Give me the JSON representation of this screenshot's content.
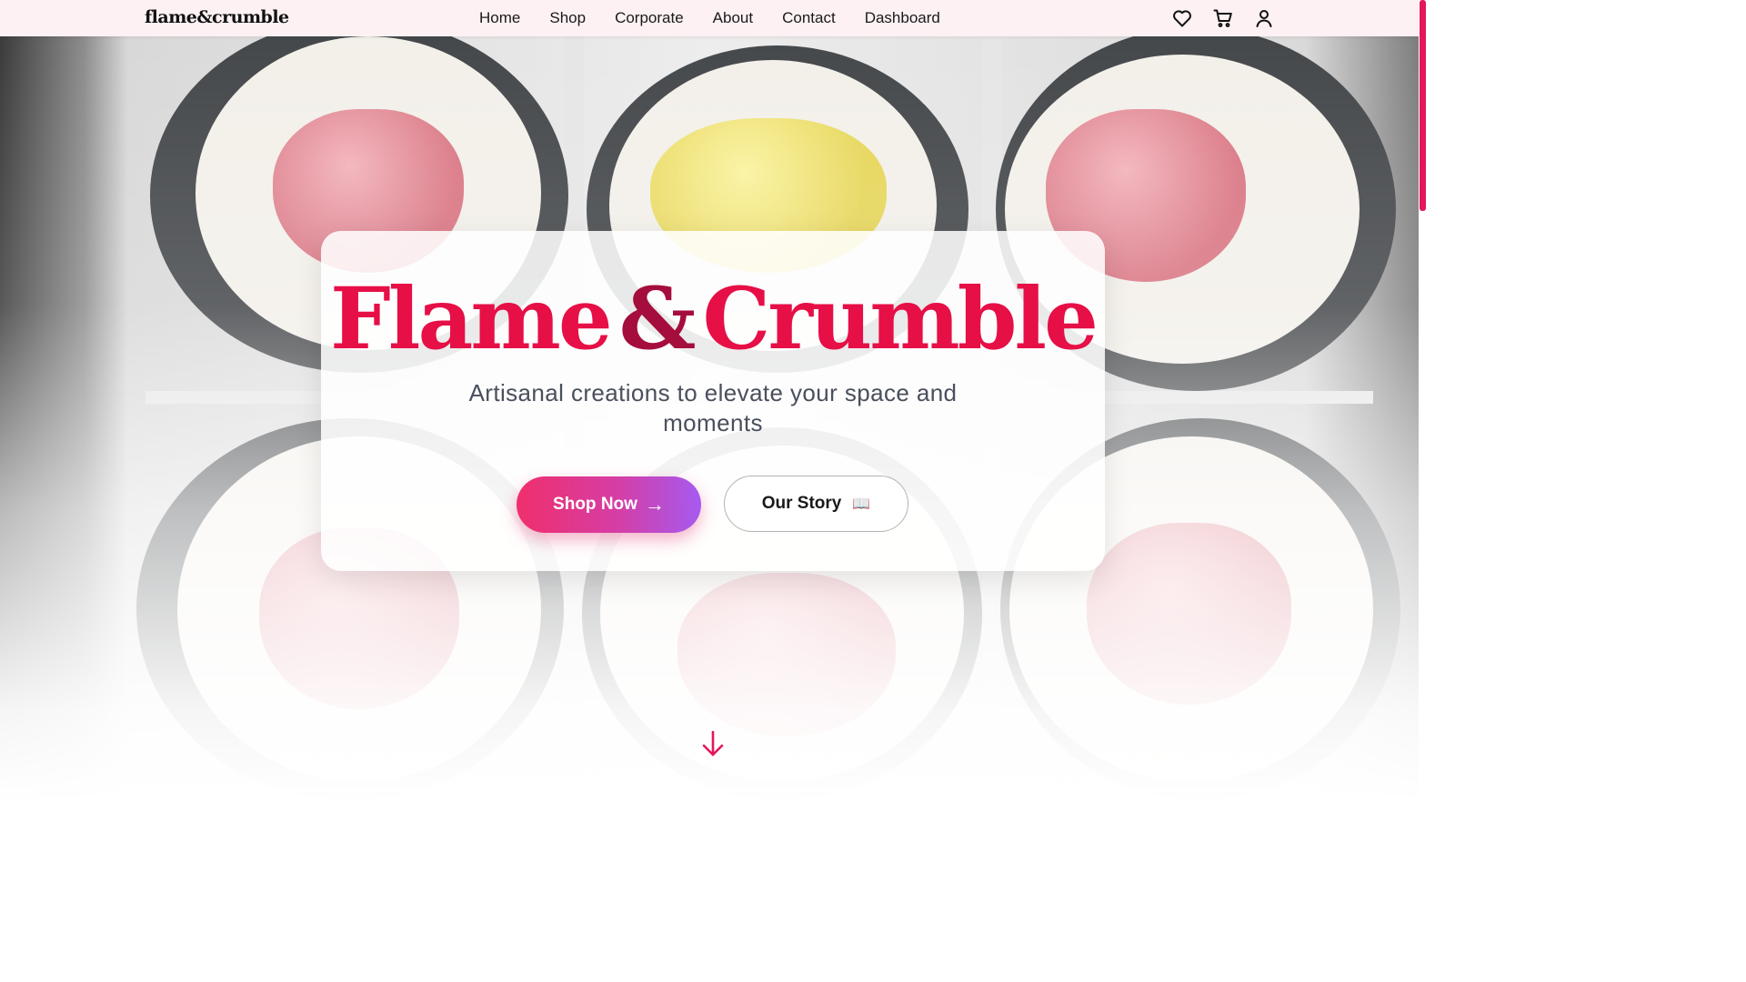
{
  "brand": {
    "logo_text": "flame&crumble"
  },
  "nav": {
    "links": [
      {
        "label": "Home"
      },
      {
        "label": "Shop"
      },
      {
        "label": "Corporate"
      },
      {
        "label": "About"
      },
      {
        "label": "Contact"
      },
      {
        "label": "Dashboard"
      }
    ],
    "icons": [
      "heart-icon",
      "cart-icon",
      "user-icon"
    ]
  },
  "hero": {
    "title_part1": "Flame",
    "title_amp": "&",
    "title_part2": "Crumble",
    "subtitle": "Artisanal creations to elevate your space and moments",
    "primary_button": {
      "label": "Shop Now",
      "icon": "→"
    },
    "secondary_button": {
      "label": "Our Story",
      "icon": "📖"
    },
    "scroll_icon": "arrow-down-icon"
  },
  "colors": {
    "accent": "#e60f46",
    "accent_dark": "#a40d3c",
    "nav_bg": "#fdf1f3",
    "gradient_start": "#ef2f6c",
    "gradient_end": "#a65af0",
    "subtitle": "#4a4f5d"
  }
}
